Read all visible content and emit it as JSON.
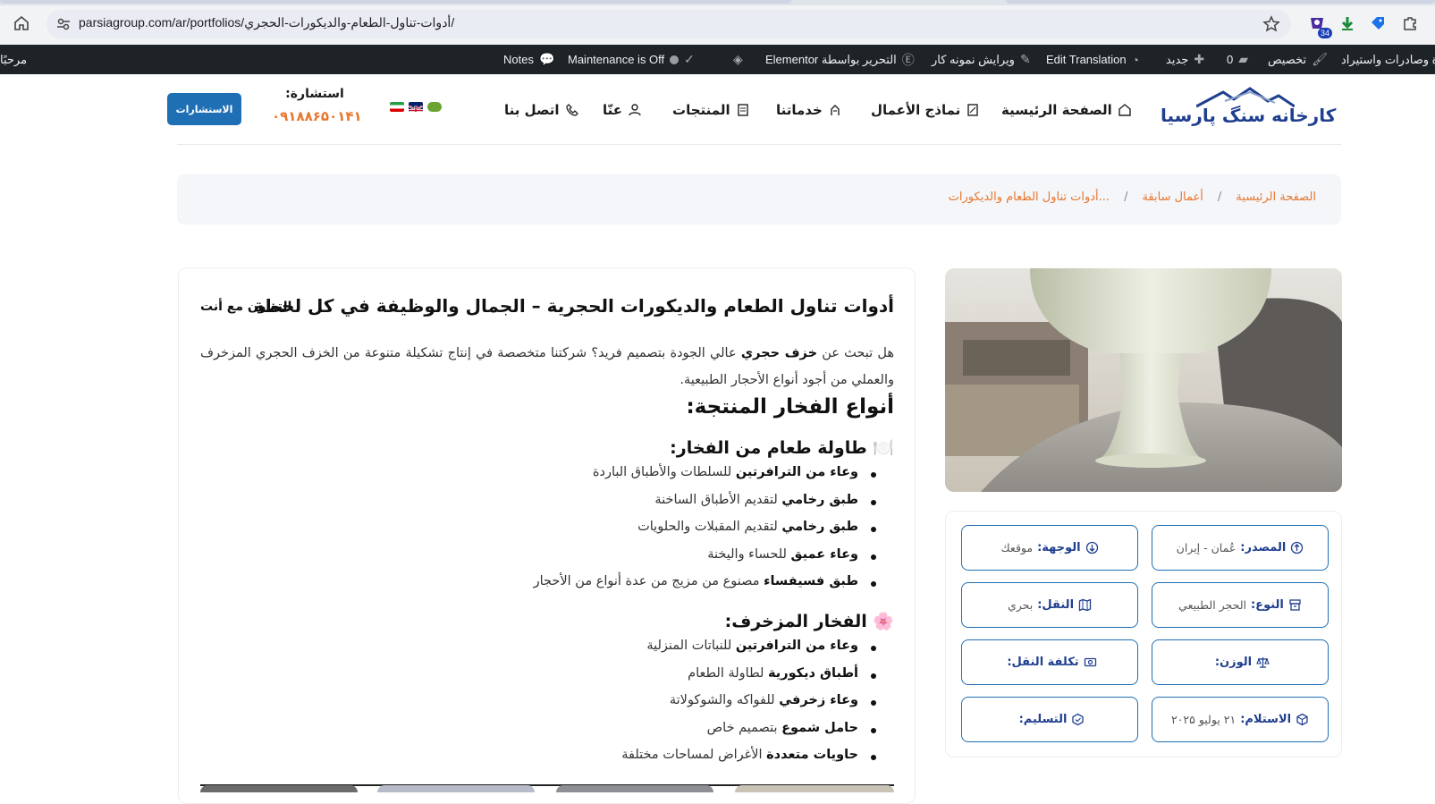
{
  "browser": {
    "url": "parsiagroup.com/ar/portfolios/أدوات-تناول-الطعام-والديكورات-الحجري/",
    "extension_badge": "34",
    "icons": [
      "home-icon",
      "site-info-icon",
      "star-icon",
      "extension-icon",
      "download-icon",
      "tag-icon",
      "puzzle-icon"
    ]
  },
  "admin_bar": {
    "greeting": "مرحبًا",
    "notes": "Notes",
    "maintenance": "Maintenance is Off",
    "elementor": "التحرير بواسطة Elementor",
    "edit_sample": "ویرایش نمونه کار",
    "edit_translation": "Edit Translation",
    "new": "جديد",
    "comments_count": "0",
    "customize": "تخصيص",
    "imports": "ة وصادرات واستيراد"
  },
  "header": {
    "logo_text": "کارخانه سنگ پارسیا",
    "nav": {
      "home": "الصفحة الرئيسية",
      "portfolio": "نماذج الأعمال",
      "services": "خدماتنا",
      "products": "المنتجات",
      "about": "عنّا",
      "contact": "اتصل بنا"
    },
    "consult_label": "استشارة:",
    "consult_phone": "۰۹۱۸۸۶۵۰۱۴۱",
    "cta_label": "الاستشارات"
  },
  "breadcrumb": {
    "home": "الصفحة الرئيسية",
    "sep": "/",
    "portfolio": "أعمال سابقة",
    "current": "أدوات تناول الطعام والديكورات..."
  },
  "article": {
    "title": "أدوات تناول الطعام والديكورات الحجرية – الجمال والوظيفة في كل لحظة",
    "title_tail": "التعاون مع أنت",
    "intro_pre": "هل تبحث عن ",
    "intro_bold": "خزف حجري",
    "intro_post": " عالي الجودة بتصميم فريد؟ شركتنا متخصصة في إنتاج تشكيلة متنوعة من الخزف الحجري المزخرف والعملي من أجود أنواع الأحجار الطبيعية.",
    "section_title": "أنواع الفخار المنتجة:",
    "group1_title": "🍽️ طاولة طعام من الفخار:",
    "group1": [
      {
        "bold": "وعاء من الترافرتين",
        "rest": " للسلطات والأطباق الباردة"
      },
      {
        "bold": "طبق رخامي",
        "rest": " لتقديم الأطباق الساخنة"
      },
      {
        "bold": "طبق رخامي",
        "rest": " لتقديم المقبلات والحلويات"
      },
      {
        "bold": "وعاء عميق",
        "rest": " للحساء واليخنة"
      },
      {
        "bold": "طبق فسيفساء",
        "rest": " مصنوع من مزيج من عدة أنواع من الأحجار"
      }
    ],
    "group2_title": "🌸 الفخار المزخرف:",
    "group2": [
      {
        "bold": "وعاء من الترافرتين",
        "rest": " للنباتات المنزلية"
      },
      {
        "bold": "أطباق ديكورية",
        "rest": " لطاولة الطعام"
      },
      {
        "bold": "وعاء زخرفي",
        "rest": " للفواكه والشوكولاتة"
      },
      {
        "bold": "حامل شموع",
        "rest": " بتصميم خاص"
      },
      {
        "bold": "حاويات متعددة",
        "rest": " الأغراض لمساحات مختلفة"
      }
    ]
  },
  "specs": {
    "source_label": "المصدر:",
    "source_value": "عُمان - إيران",
    "facade_label": "الوجهة:",
    "facade_value": "موقعك",
    "type_label": "النوع:",
    "type_value": "الحجر الطبيعي",
    "transport_label": "النقل:",
    "transport_value": "بحري",
    "weight_label": "الوزن:",
    "weight_value": "",
    "transport_cost_label": "تكلفة النقل:",
    "transport_cost_value": "",
    "receipt_label": "الاستلام:",
    "receipt_value": "۲۱ يوليو ۲۰۲۵",
    "delivery_label": "التسليم:",
    "delivery_value": ""
  },
  "colors": {
    "accent_orange": "#e8772e",
    "brand_blue": "#1f6fb5",
    "admin_bar": "#1d2327"
  }
}
